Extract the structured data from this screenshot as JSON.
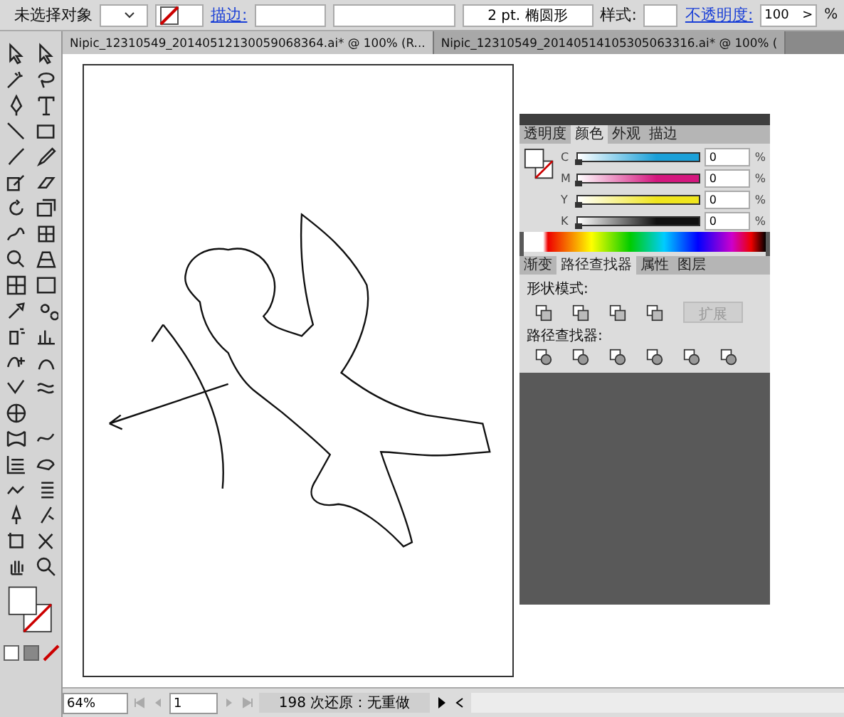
{
  "control_bar": {
    "selection": "未选择对象",
    "stroke_link": "描边:",
    "brush": "2 pt. 椭圆形",
    "style_label": "样式:",
    "opacity_link": "不透明度:",
    "opacity_value": "100",
    "opacity_arrow": ">",
    "opacity_unit": "%"
  },
  "document_tabs": [
    {
      "label": "Nipic_12310549_20140512130059068364.ai* @ 100% (R...",
      "selected": true
    },
    {
      "label": "Nipic_12310549_20140514105305063316.ai* @ 100% (",
      "selected": false
    }
  ],
  "color_panel": {
    "tabs": [
      {
        "label": "透明度",
        "selected": false
      },
      {
        "label": "颜色",
        "selected": true
      },
      {
        "label": "外观",
        "selected": false
      },
      {
        "label": "描边",
        "selected": false
      }
    ],
    "channels": [
      {
        "name": "C",
        "color": "#1aa0d8",
        "level": 0,
        "value": "0",
        "unit": "%"
      },
      {
        "name": "M",
        "color": "#d4177e",
        "level": 0,
        "value": "0",
        "unit": "%"
      },
      {
        "name": "Y",
        "color": "#f0e61e",
        "level": 0,
        "value": "0",
        "unit": "%"
      },
      {
        "name": "K",
        "color": "#111111",
        "level": 0,
        "value": "0",
        "unit": "%"
      }
    ]
  },
  "pathfinder_panel": {
    "tabs": [
      {
        "label": "渐变",
        "selected": false
      },
      {
        "label": "路径查找器",
        "selected": true
      },
      {
        "label": "属性",
        "selected": false
      },
      {
        "label": "图层",
        "selected": false
      }
    ],
    "shape_modes_title": "形状模式:",
    "expand_button": {
      "label": "扩展",
      "disabled": true
    },
    "pathfinders_title": "路径查找器:"
  },
  "status_bar": {
    "zoom": "64%",
    "artboard": "1",
    "status": "198 次还原：无重做"
  }
}
